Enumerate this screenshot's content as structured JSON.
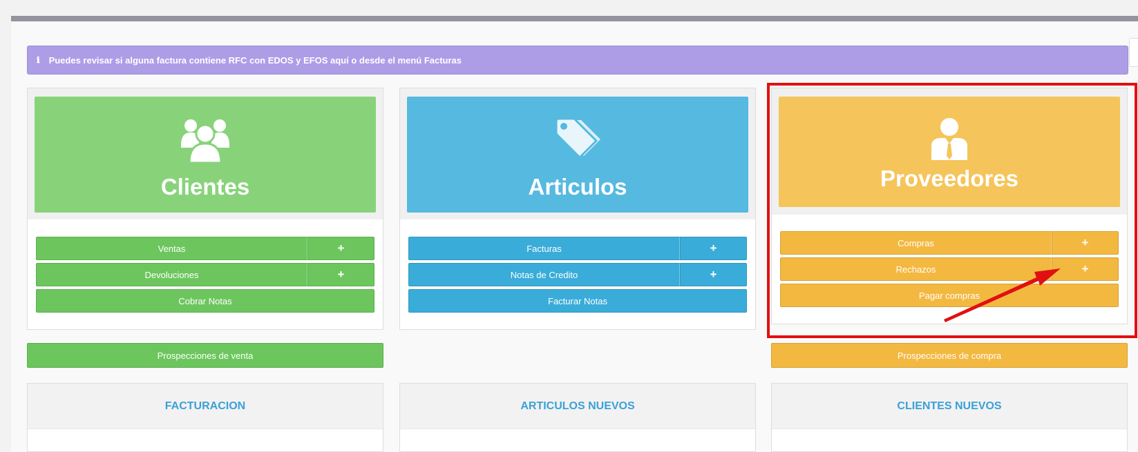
{
  "alert": {
    "icon": "info-icon",
    "text": "Puedes revisar si alguna factura contiene RFC con EDOS y EFOS aquí o desde el menú Facturas"
  },
  "clientes": {
    "title": "Clientes",
    "icon": "users-icon",
    "buttons": [
      {
        "label": "Ventas",
        "plus": "+"
      },
      {
        "label": "Devoluciones",
        "plus": "+"
      }
    ],
    "full_button": "Cobrar Notas"
  },
  "articulos": {
    "title": "Articulos",
    "icon": "tags-icon",
    "buttons": [
      {
        "label": "Facturas",
        "plus": "+"
      },
      {
        "label": "Notas de Credito",
        "plus": "+"
      }
    ],
    "full_button": "Facturar Notas"
  },
  "proveedores": {
    "title": "Proveedores",
    "icon": "user-tie-icon",
    "buttons": [
      {
        "label": "Compras",
        "plus": "+"
      },
      {
        "label": "Rechazos",
        "plus": "+"
      }
    ],
    "full_button": "Pagar compras"
  },
  "prospecciones": {
    "venta": "Prospecciones de venta",
    "compra": "Prospecciones de compra"
  },
  "bottom_panels": [
    "FACTURACION",
    "ARTICULOS NUEVOS",
    "CLIENTES NUEVOS"
  ],
  "colors": {
    "green": "#6cc65d",
    "blue": "#3aacd9",
    "yellow": "#f3b840",
    "alert": "#ad9de6",
    "highlight": "#e11010"
  }
}
